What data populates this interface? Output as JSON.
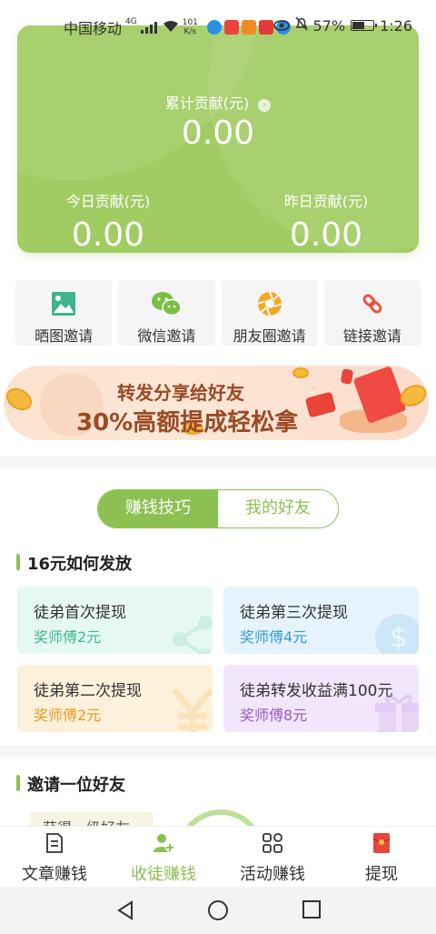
{
  "status_bar": {
    "carrier": "中国移动",
    "signal_tag": "4G",
    "net_speed_value": "101",
    "net_speed_unit": "K/s",
    "battery": "57%",
    "time": "1:26"
  },
  "summary": {
    "total_label": "累计贡献(元)",
    "total_value": "0.00",
    "today_label": "今日贡献(元)",
    "today_value": "0.00",
    "yesterday_label": "昨日贡献(元)",
    "yesterday_value": "0.00"
  },
  "invite_methods": [
    {
      "label": "晒图邀请",
      "icon": "image-icon"
    },
    {
      "label": "微信邀请",
      "icon": "wechat-icon"
    },
    {
      "label": "朋友圈邀请",
      "icon": "moments-icon"
    },
    {
      "label": "链接邀请",
      "icon": "link-icon"
    }
  ],
  "banner": {
    "line1": "转发分享给好友",
    "line2": "30%高额提成轻松拿"
  },
  "tabs_toggle": {
    "active": "赚钱技巧",
    "inactive": "我的好友"
  },
  "section_payout": {
    "title": "16元如何发放",
    "cards": [
      {
        "title": "徒弟首次提现",
        "reward": "奖师傅2元",
        "bg": "#e6f8f3",
        "accent": "#3cb98f"
      },
      {
        "title": "徒弟第三次提现",
        "reward": "奖师傅4元",
        "bg": "#e4f3fc",
        "accent": "#3a9bd5"
      },
      {
        "title": "徒弟第二次提现",
        "reward": "奖师傅2元",
        "bg": "#fdf1dc",
        "accent": "#e89a20"
      },
      {
        "title": "徒弟转发收益满100元",
        "reward": "奖师傅8元",
        "bg": "#f1e6fb",
        "accent": "#9b59c7"
      }
    ]
  },
  "section_invite": {
    "title": "邀请一位好友",
    "partial_card_text": "获得一级好友"
  },
  "bottom_tabs": [
    {
      "label": "文章赚钱",
      "icon": "article-icon",
      "active": false
    },
    {
      "label": "收徒赚钱",
      "icon": "add-friend-icon",
      "active": true
    },
    {
      "label": "活动赚钱",
      "icon": "grid-icon",
      "active": false
    },
    {
      "label": "提现",
      "icon": "red-envelope-icon",
      "active": false
    }
  ],
  "colors": {
    "accent_green": "#8cc152",
    "card_green": "#a1cc63"
  }
}
